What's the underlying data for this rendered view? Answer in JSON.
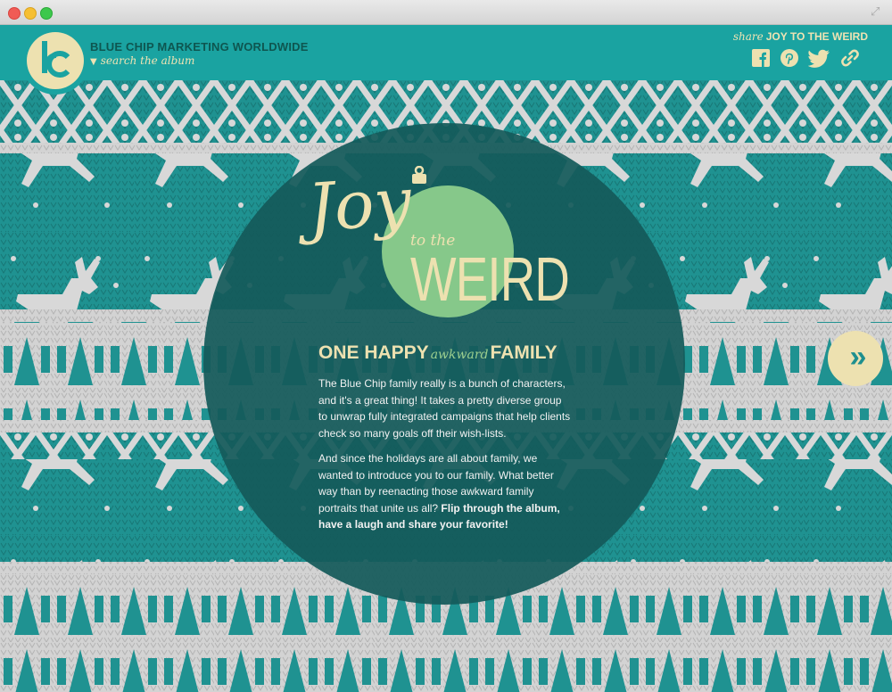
{
  "header": {
    "brand": "BLUE CHIP MARKETING WORLDWIDE",
    "search": "search the album",
    "share_label": "share",
    "share_title": "JOY TO THE WEIRD",
    "social": [
      "facebook-icon",
      "pinterest-icon",
      "twitter-icon",
      "link-icon"
    ]
  },
  "hero": {
    "title_joy": "Joy",
    "title_tothe": "to the",
    "title_weird": "WEIRD",
    "headline_1": "ONE HAPPY",
    "headline_aw": "awkward",
    "headline_2": "FAMILY",
    "para1": "The Blue Chip family really is a bunch of characters, and it's a great thing! It takes a pretty diverse group to unwrap fully integrated campaigns that help clients check so many goals off their wish-lists.",
    "para2_plain": "And since the holidays are all about family, we wanted to introduce you to our family. What better way than by reenacting those awkward family portraits that unite us all? ",
    "para2_bold": "Flip through the album, have a laugh and share your favorite!"
  },
  "nav": {
    "next": "»"
  },
  "colors": {
    "teal": "#1aa3a1",
    "dark_teal": "#145a5a",
    "cream": "#ede1b0",
    "green": "#86c88a"
  }
}
